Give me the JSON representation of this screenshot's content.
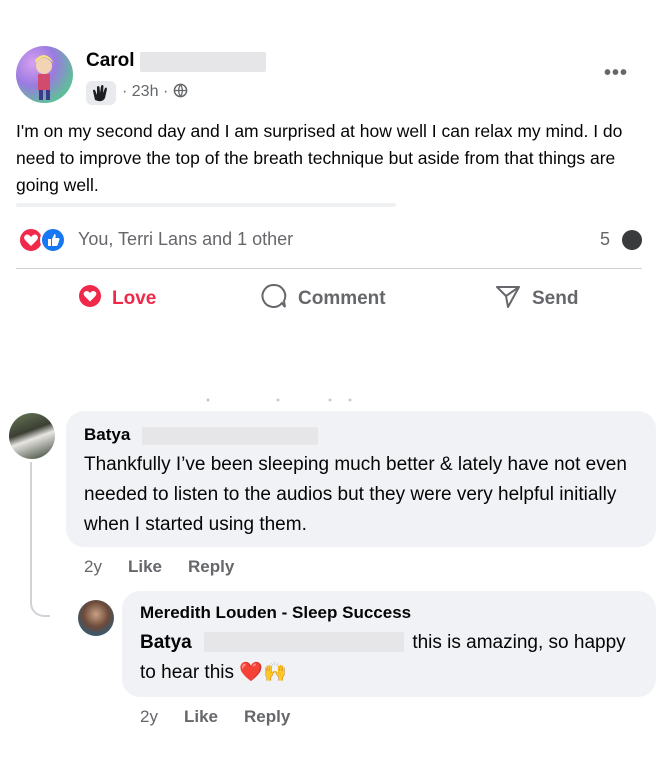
{
  "post": {
    "author": "Carol",
    "time": "23h",
    "separator": "·",
    "text": "I'm on my second day and I am surprised at how well I can relax my mind. I do need to improve the top of the breath technique but aside from that things are going well.",
    "more_label": "•••"
  },
  "reactions": {
    "label": "You, Terri Lans and 1 other",
    "comment_count": "5",
    "colors": {
      "love": "#f0284a",
      "like": "#1877f2"
    }
  },
  "actions": {
    "love": "Love",
    "comment": "Comment",
    "send": "Send"
  },
  "comments": [
    {
      "author": "Batya",
      "text": "Thankfully I’ve been sleeping much better & lately have not even needed to listen to the audios but they were very helpful initially when I started using them.",
      "time": "2y",
      "like": "Like",
      "reply": "Reply"
    },
    {
      "author": "Meredith Louden - Sleep Success",
      "mention": "Batya",
      "text_after": "this is amazing, so happy to hear this",
      "emoji": "❤️🙌",
      "time": "2y",
      "like": "Like",
      "reply": "Reply"
    }
  ],
  "icons": {
    "badge": "waving-hand-icon",
    "audience": "globe-icon",
    "more": "more-options-icon",
    "love": "heart-icon",
    "comment": "comment-bubble-icon",
    "send": "send-arrow-icon"
  }
}
